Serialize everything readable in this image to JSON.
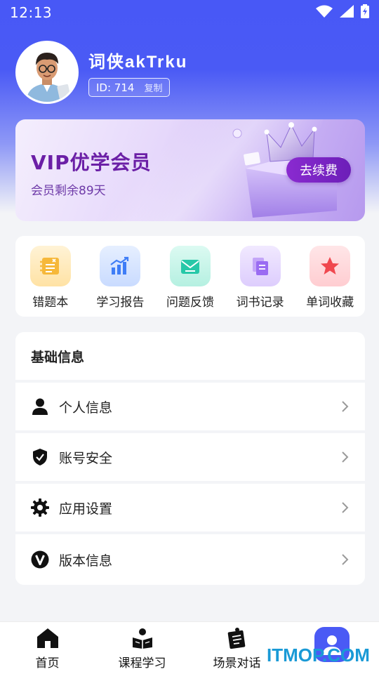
{
  "status_bar": {
    "time": "12:13",
    "icons": [
      "wifi-icon",
      "signal-icon",
      "battery-icon"
    ]
  },
  "profile": {
    "username": "词侠akTrku",
    "id_text": "ID: 714",
    "copy_label": "复制"
  },
  "vip": {
    "title": "VIP优学会员",
    "subtitle": "会员剩余89天",
    "renew_label": "去续费"
  },
  "shortcuts": [
    {
      "label": "错题本",
      "icon": "notebook-icon",
      "color": "#f6b83a"
    },
    {
      "label": "学习报告",
      "icon": "report-chart-icon",
      "color": "#3f7df6"
    },
    {
      "label": "问题反馈",
      "icon": "feedback-mail-icon",
      "color": "#27c8a8"
    },
    {
      "label": "词书记录",
      "icon": "books-icon",
      "color": "#9a6cf2"
    },
    {
      "label": "单词收藏",
      "icon": "star-icon",
      "color": "#f0484f"
    }
  ],
  "info": {
    "header": "基础信息",
    "rows": [
      {
        "label": "个人信息",
        "icon": "user-icon"
      },
      {
        "label": "账号安全",
        "icon": "shield-check-icon"
      },
      {
        "label": "应用设置",
        "icon": "gear-icon"
      },
      {
        "label": "版本信息",
        "icon": "version-v-icon"
      }
    ]
  },
  "bottom_nav": [
    {
      "label": "首页",
      "icon": "home-icon"
    },
    {
      "label": "课程学习",
      "icon": "reading-icon"
    },
    {
      "label": "场景对话",
      "icon": "clipboard-pin-icon"
    },
    {
      "label": "",
      "icon": "profile-icon",
      "active": true
    }
  ],
  "watermark": "ITMOP.COM",
  "colors": {
    "accent": "#4a5af5",
    "vip_purple": "#6b1fa6",
    "background": "#f3f4f7"
  }
}
